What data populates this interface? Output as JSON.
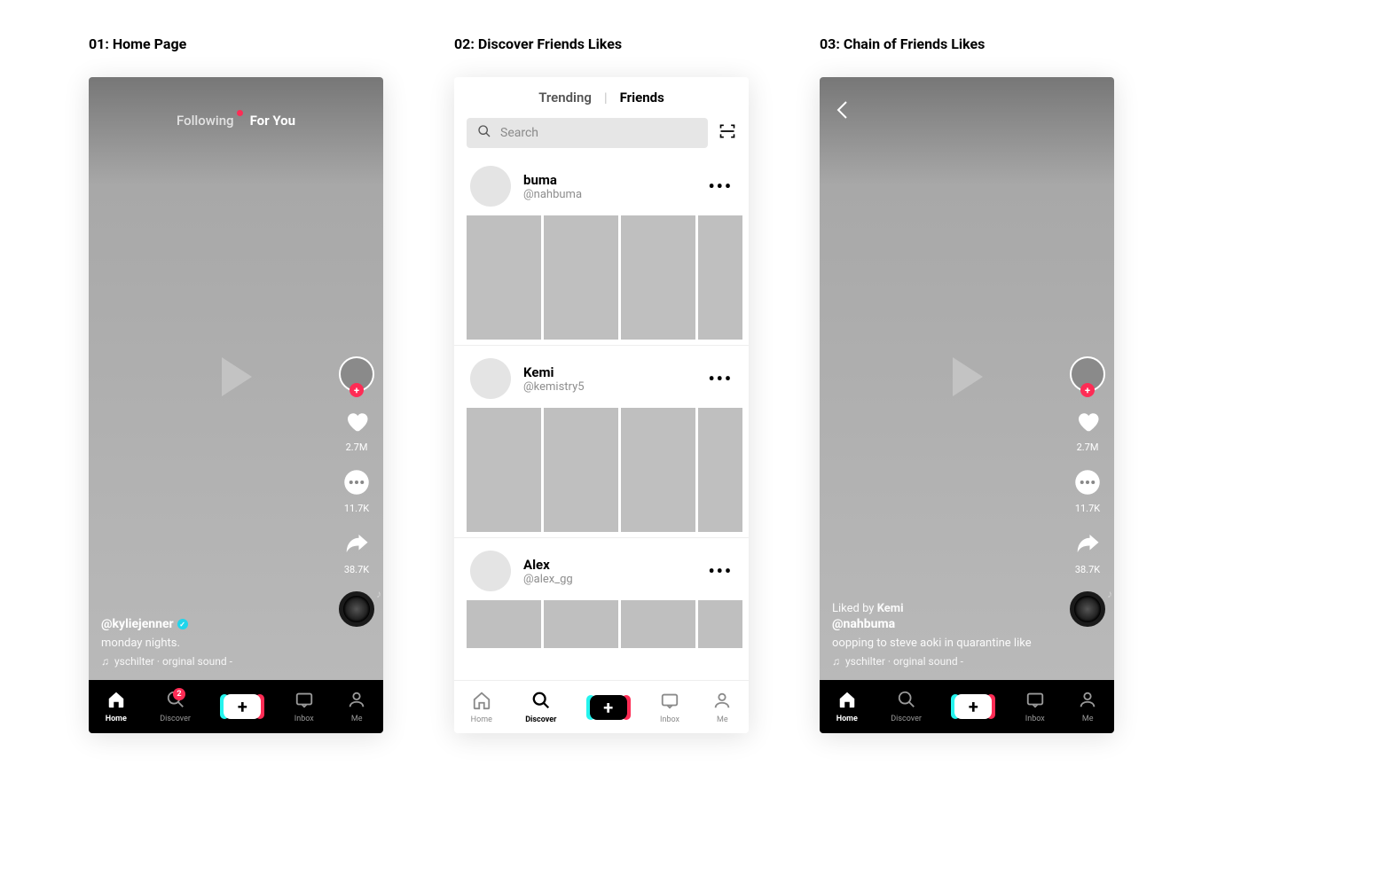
{
  "columns": [
    {
      "title": "01: Home Page"
    },
    {
      "title": "02: Discover Friends Likes"
    },
    {
      "title": "03: Chain of Friends Likes"
    }
  ],
  "nav": {
    "home": "Home",
    "discover": "Discover",
    "inbox": "Inbox",
    "me": "Me",
    "inbox_badge": "2"
  },
  "home": {
    "tab_following": "Following",
    "tab_foryou": "For You",
    "username": "@kyliejenner",
    "caption": "monday nights.",
    "sound": "yschilter · orginal sound -",
    "likes": "2.7M",
    "comments": "11.7K",
    "shares": "38.7K"
  },
  "discover": {
    "tab_trending": "Trending",
    "tab_friends": "Friends",
    "search_placeholder": "Search",
    "friends": [
      {
        "name": "buma",
        "handle": "@nahbuma"
      },
      {
        "name": "Kemi",
        "handle": "@kemistry5"
      },
      {
        "name": "Alex",
        "handle": "@alex_gg"
      }
    ]
  },
  "chain": {
    "liked_by_prefix": "Liked by ",
    "liked_by_name": "Kemi",
    "username": "@nahbuma",
    "caption": "oopping  to steve aoki in quarantine like",
    "sound": "yschilter · orginal sound -",
    "likes": "2.7M",
    "comments": "11.7K",
    "shares": "38.7K"
  }
}
